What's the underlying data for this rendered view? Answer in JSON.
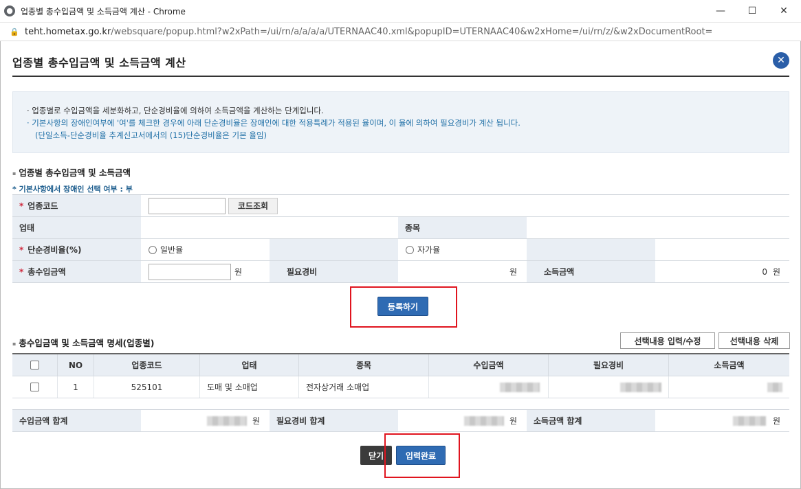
{
  "window": {
    "title": "업종별 총수입금액 및 소득금액 계산 - Chrome",
    "url_host": "teht.hometax.go.kr",
    "url_path": "/websquare/popup.html?w2xPath=/ui/rn/a/a/a/a/UTERNAAC40.xml&popupID=UTERNAAC40&w2xHome=/ui/rn/z/&w2xDocumentRoot=",
    "min_icon": "—",
    "max_icon": "☐",
    "close_icon": "✕"
  },
  "popup": {
    "title": "업종별 총수입금액 및 소득금액 계산",
    "close_icon": "✕"
  },
  "info": {
    "line1": "· 업종별로 수입금액을 세분화하고, 단순경비율에 의하여 소득금액을 계산하는 단계입니다.",
    "line2": "· 기본사항의 장애인여부에 '여'를 체크한 경우에 아래 단순경비율은 장애인에 대한 적용특례가 적용된 율이며, 이 율에 의하여 필요경비가 계산 됩니다.",
    "line3": "(단일소득-단순경비율 추계신고서에서의 (15)단순경비율은 기본 율임)"
  },
  "section1": {
    "title": "업종별 총수입금액 및 소득금액",
    "note": "* 기본사항에서 장애인 선택 여부 : 부",
    "industry_code_label": "업종코드",
    "code_lookup_button": "코드조회",
    "business_type_label": "업태",
    "item_label": "종목",
    "rate_label": "단순경비율(%)",
    "general_rate_option": "일반율",
    "own_rate_option": "자가율",
    "total_income_label": "총수입금액",
    "won": "원",
    "expense_label": "필요경비",
    "income_label": "소득금액",
    "income_value": "0",
    "register_button": "등록하기"
  },
  "section2": {
    "title": "총수입금액 및 소득금액 명세(업종별)",
    "edit_selected_button": "선택내용 입력/수정",
    "delete_selected_button": "선택내용 삭제",
    "columns": [
      "NO",
      "업종코드",
      "업태",
      "종목",
      "수입금액",
      "필요경비",
      "소득금액"
    ],
    "rows": [
      {
        "no": "1",
        "code": "525101",
        "type": "도매 및 소매업",
        "item": "전자상거래 소매업"
      }
    ]
  },
  "totals": {
    "income_total_label": "수입금액 합계",
    "expense_total_label": "필요경비 합계",
    "earnings_total_label": "소득금액 합계",
    "won": "원"
  },
  "footer": {
    "close_button": "닫기",
    "complete_button": "입력완료"
  }
}
